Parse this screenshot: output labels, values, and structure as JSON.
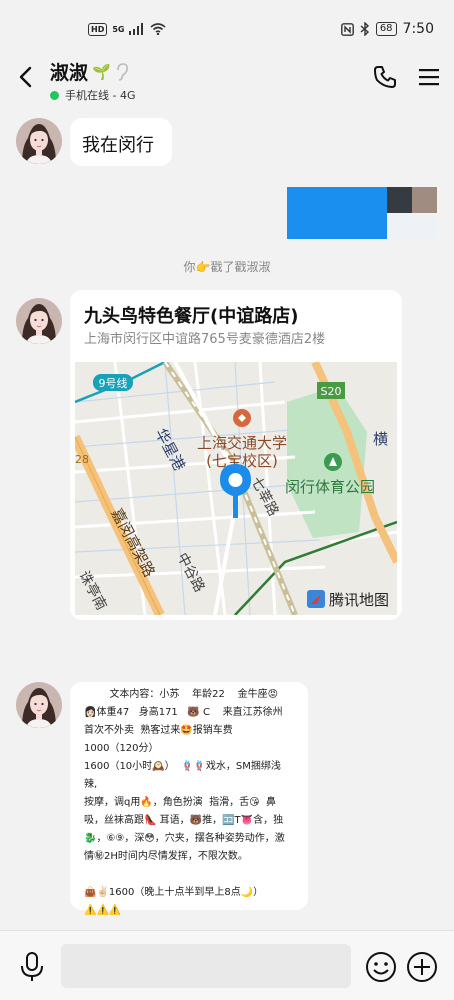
{
  "status_bar": {
    "network_badge": "HD",
    "network_type": "5G",
    "battery": "68",
    "time": "7:50"
  },
  "header": {
    "contact_name": "淑淑",
    "plant_emoji": "🌱",
    "online_status": "手机在线 - 4G"
  },
  "messages": [
    {
      "type": "text",
      "text": "我在闵行"
    },
    {
      "type": "notice",
      "text": "你👉戳了戳淑淑"
    },
    {
      "type": "location",
      "name": "九头鸟特色餐厅(中谊路店)",
      "address": "上海市闵行区中谊路765号麦豪德酒店2楼",
      "map": {
        "labels": {
          "metro": "9号线",
          "expressway": "S20",
          "poi_university": "上海交通大学",
          "poi_campus": "(七宝校区)",
          "poi_park": "闵行体育公园",
          "road_huaxing": "华星港",
          "road_qixin": "七莘路",
          "road_heng": "横",
          "road_zhonggu": "中谷路",
          "road_jiaguan": "嘉闵高架路",
          "road_zhuting": "诛亭南",
          "road_edge": "28",
          "watermark": "腾讯地图"
        }
      }
    },
    {
      "type": "text",
      "lines": [
        "        文本内容：小苏    年龄22    金牛座😡",
        "👩🏻体重47   身高171   🐻 C    来直江苏徐州",
        "首次不外卖  熟客过来🤩报销车费",
        "1000（120分）",
        "1600（10小时🕰️）  🪢🪢戏水，SM捆绑浅辣,",
        "按摩，调q用🔥，角色扮演  指滑，舌😘  鼻",
        "吸，丝袜高跟👠 耳语，🐻推，🈁T👅含，独",
        "🐉，⑥⑨，深😳，穴夹，摆各种姿势动作，激",
        "情㊙2H时间内尽情发挥，不限次数。",
        "",
        "👜✌🏻1600（晚上十点半到早上8点🌙）",
        "⚠️⚠️⚠️"
      ]
    }
  ],
  "input": {
    "placeholder": ""
  }
}
